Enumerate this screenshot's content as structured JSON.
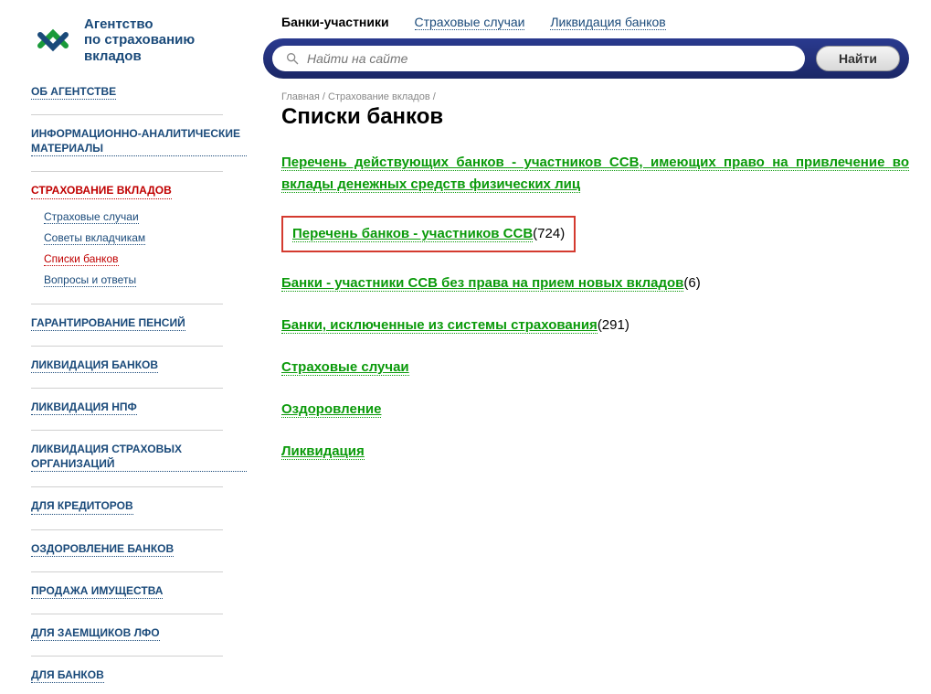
{
  "logo": {
    "line1": "Агентство",
    "line2": "по страхованию",
    "line3": "вкладов"
  },
  "nav": {
    "about": "ОБ АГЕНТСТВЕ",
    "analytics": "ИНФОРМАЦИОННО-АНАЛИТИЧЕСКИЕ МАТЕРИАЛЫ",
    "insurance": "СТРАХОВАНИЕ ВКЛАДОВ",
    "sub": {
      "cases": "Страховые случаи",
      "advice": "Советы вкладчикам",
      "lists": "Списки банков",
      "qa": "Вопросы и ответы"
    },
    "pension": "ГАРАНТИРОВАНИЕ ПЕНСИЙ",
    "liq_banks": "ЛИКВИДАЦИЯ БАНКОВ",
    "liq_npf": "ЛИКВИДАЦИЯ НПФ",
    "liq_ins": "ЛИКВИДАЦИЯ СТРАХОВЫХ ОРГАНИЗАЦИЙ",
    "creditors": "ДЛЯ КРЕДИТОРОВ",
    "recover": "ОЗДОРОВЛЕНИЕ БАНКОВ",
    "sale": "ПРОДАЖА ИМУЩЕСТВА",
    "borrowers": "ДЛЯ ЗАЕМЩИКОВ ЛФО",
    "for_banks": "ДЛЯ БАНКОВ"
  },
  "tabs": {
    "t1": "Банки-участники",
    "t2": "Страховые случаи",
    "t3": "Ликвидация банков"
  },
  "search": {
    "placeholder": "Найти на сайте",
    "button": "Найти"
  },
  "crumbs": "Главная / Страхование вкладов /",
  "title": "Списки банков",
  "links": {
    "l1": "Перечень действующих банков - участников ССВ, имеющих право на привлечение во вклады денежных средств физических лиц",
    "l2": "Перечень банков - участников ССВ",
    "l2_count": "(724)",
    "l3": "Банки - участники ССВ без права на прием новых вкладов",
    "l3_count": "(6)",
    "l4": "Банки, исключенные из системы страхования",
    "l4_count": "(291)",
    "l5": "Страховые случаи",
    "l6": "Оздоровление",
    "l7": "Ликвидация"
  }
}
